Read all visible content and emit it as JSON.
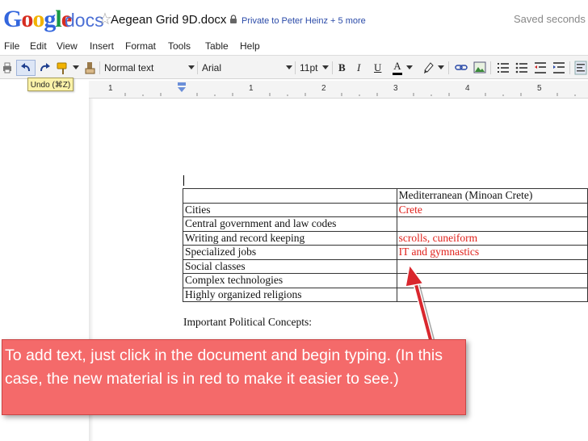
{
  "header": {
    "logo": "Google",
    "product": "docs",
    "doc_title": "Aegean Grid 9D.docx",
    "sharing": "Private to Peter Heinz + 5 more",
    "save_status": "Saved seconds a"
  },
  "menu": [
    "File",
    "Edit",
    "View",
    "Insert",
    "Format",
    "Tools",
    "Table",
    "Help"
  ],
  "toolbar": {
    "style_select": "Normal text",
    "font_select": "Arial",
    "size_select": "11pt",
    "bold": "B",
    "italic": "I",
    "underline": "U",
    "text_color": "A"
  },
  "tooltip": "Undo (⌘Z)",
  "ruler": [
    "1",
    "1",
    "2",
    "3",
    "4",
    "5"
  ],
  "table": {
    "header": [
      "",
      "Mediterranean (Minoan Crete)"
    ],
    "rows": [
      {
        "label": "Cities",
        "value": "Crete"
      },
      {
        "label": "Central government and law codes",
        "value": ""
      },
      {
        "label": "Writing and record keeping",
        "value": "scrolls, cuneiform"
      },
      {
        "label": "Specialized jobs",
        "value": "IT and gymnastics"
      },
      {
        "label": "Social classes",
        "value": ""
      },
      {
        "label": "Complex technologies",
        "value": ""
      },
      {
        "label": "Highly organized religions",
        "value": ""
      }
    ]
  },
  "political_heading": "Important Political Concepts:",
  "callout": "To add text, just click in the document and begin typing. (In this case, the new material is in red to make it easier to see.)",
  "colors": {
    "new_text": "#e0201a",
    "callout_bg": "#f46a6a",
    "google_blue": "#3366dd",
    "google_red": "#d62d20",
    "google_yellow": "#f2b200",
    "google_green": "#199946"
  }
}
